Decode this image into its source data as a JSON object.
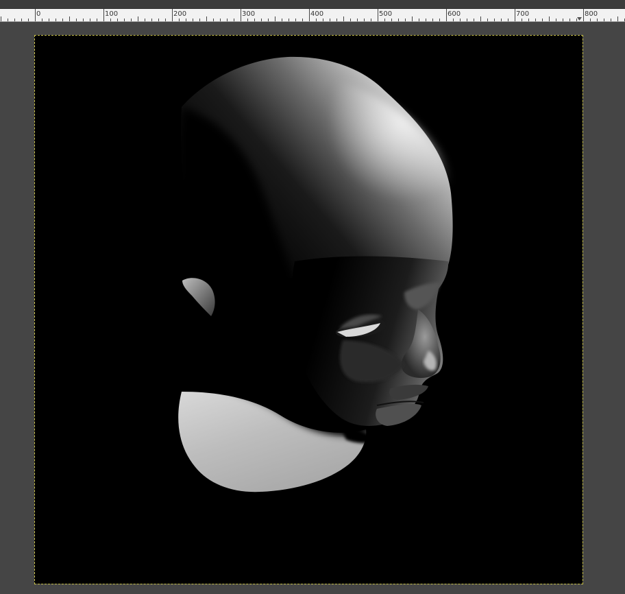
{
  "ruler": {
    "labels": [
      "0",
      "100",
      "200",
      "300",
      "400",
      "500",
      "600",
      "700",
      "800"
    ]
  },
  "canvas": {
    "background": "#000000",
    "workspace_color": "#454545",
    "boundary_color": "#c9c24a",
    "subject": "rendered-head"
  }
}
